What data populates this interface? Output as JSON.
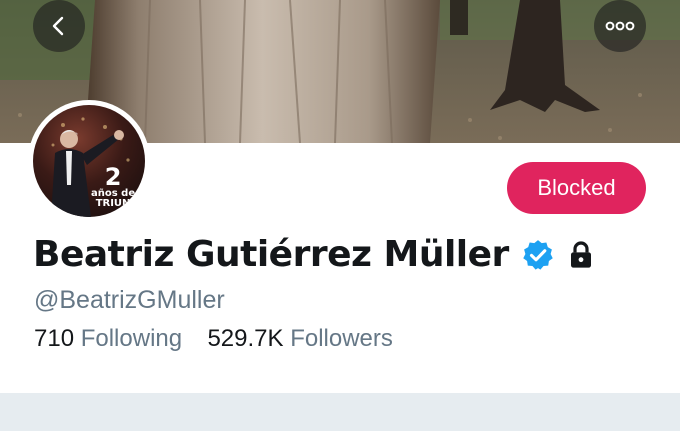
{
  "header": {
    "back_icon": "chevron-left-icon",
    "more_icon": "ellipsis-icon"
  },
  "profile": {
    "avatar_badge_number": "2",
    "avatar_badge_text_1": "años de",
    "avatar_badge_text_2": "TRIUN",
    "display_name": "Beatriz Gutiérrez Müller",
    "handle": "@BeatrizGMuller",
    "verified_icon": "verified-badge-icon",
    "protected_icon": "lock-icon",
    "blocked_label": "Blocked",
    "following_count": "710",
    "following_label": "Following",
    "followers_count": "529.7K",
    "followers_label": "Followers"
  },
  "colors": {
    "blocked_button": "#e0245e",
    "verified": "#1da1f2",
    "muted_text": "#657786",
    "primary_text": "#14171a",
    "divider_band": "#e6ecf0"
  }
}
